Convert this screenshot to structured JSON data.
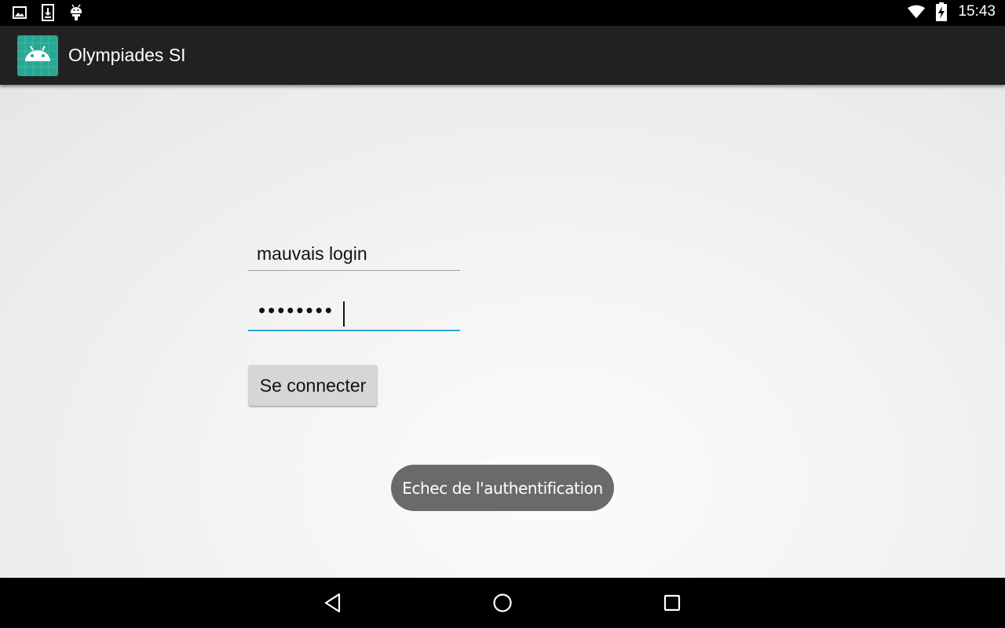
{
  "status_bar": {
    "time": "15:43",
    "icons_left": [
      "image-notification-icon",
      "download-notification-icon",
      "android-debug-icon"
    ],
    "icons_right": [
      "wifi-icon",
      "battery-charging-icon"
    ]
  },
  "app_bar": {
    "title": "Olympiades SI",
    "icon": "android-app-icon",
    "icon_color": "#28a795"
  },
  "form": {
    "login_value": "mauvais login",
    "password_value": "••••••••",
    "connect_button_label": "Se connecter",
    "accent_color": "#2aa9d9"
  },
  "toast": {
    "message": "Echec de l'authentification"
  },
  "nav_bar": {
    "buttons": [
      "back-icon",
      "home-icon",
      "recent-apps-icon"
    ]
  }
}
